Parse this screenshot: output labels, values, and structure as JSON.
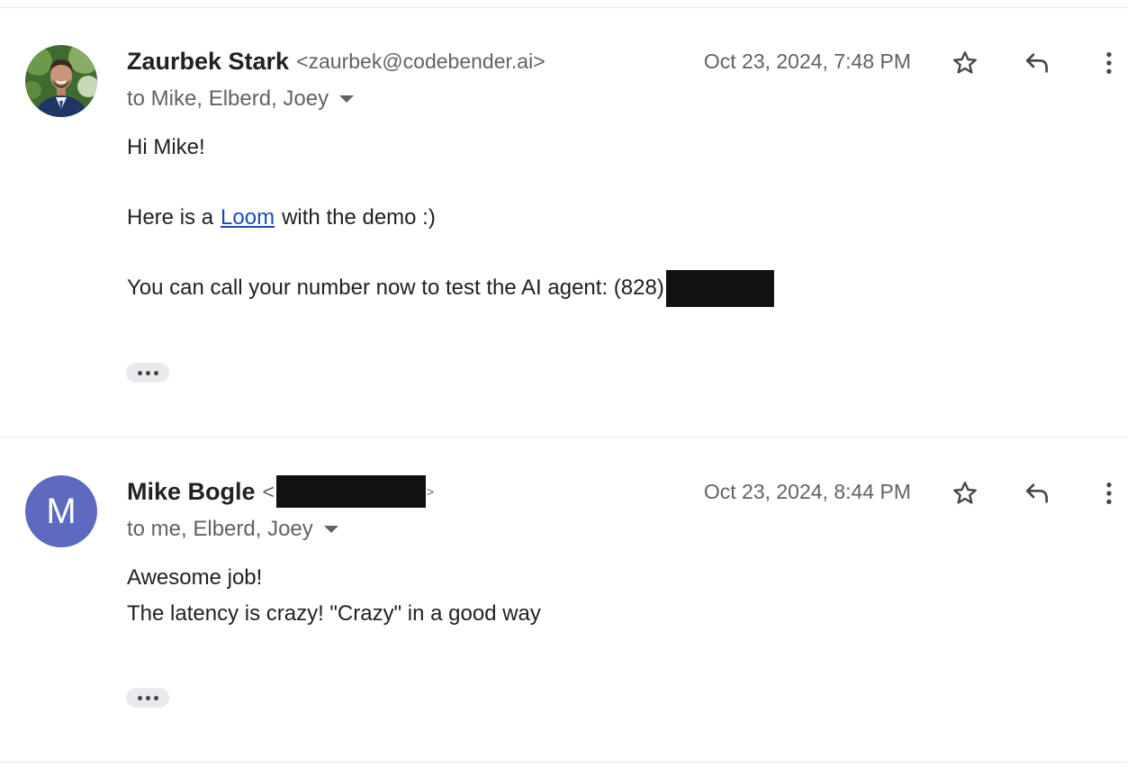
{
  "messages": [
    {
      "sender_name": "Zaurbek Stark",
      "sender_email": "<zaurbek@codebender.ai>",
      "recipients": "to Mike, Elberd, Joey",
      "date": "Oct 23, 2024, 7:48 PM",
      "greeting": "Hi Mike!",
      "line2_before": "Here is a",
      "line2_link": "Loom",
      "line2_after": "with the demo :)",
      "line3": "You can call your number now to test the AI agent: (828)"
    },
    {
      "sender_name": "Mike Bogle",
      "avatar_letter": "M",
      "email_open": "<",
      "email_close": ">",
      "recipients": "to me, Elberd, Joey",
      "date": "Oct 23, 2024, 8:44 PM",
      "line1": "Awesome job!",
      "line2": "The latency is crazy! \"Crazy\" in a good way"
    }
  ],
  "colors": {
    "avatar_bg": "#5c6bc0",
    "link": "#1a4dad",
    "redaction": "#111111"
  },
  "icons": [
    "star-icon",
    "reply-icon",
    "more-vert-icon",
    "chevron-down-icon",
    "ellipsis-icon"
  ]
}
